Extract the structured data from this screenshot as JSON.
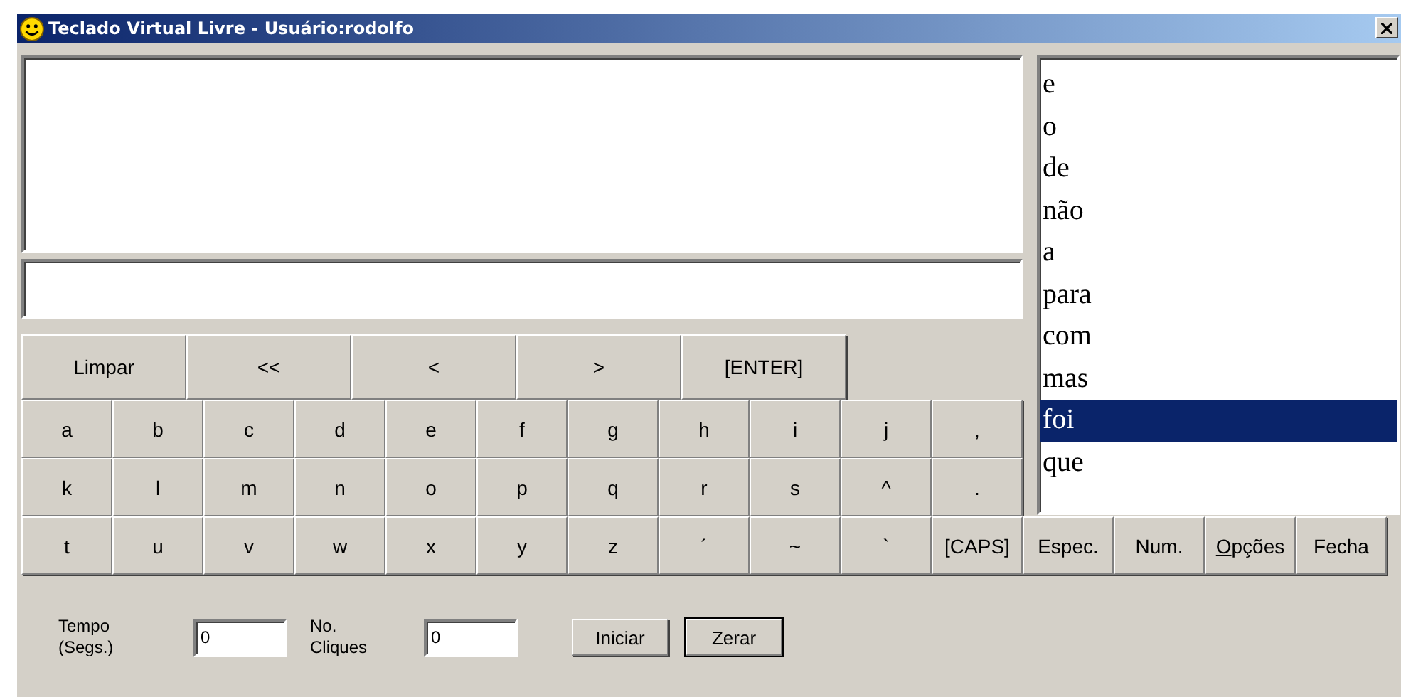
{
  "window": {
    "title": "Teclado Virtual Livre - Usuário:rodolfo"
  },
  "command_buttons": [
    "Limpar",
    "<<",
    "<",
    ">",
    "[ENTER]"
  ],
  "words": [
    {
      "label": "e",
      "selected": false
    },
    {
      "label": "o",
      "selected": false
    },
    {
      "label": "de",
      "selected": false
    },
    {
      "label": "não",
      "selected": false
    },
    {
      "label": "a",
      "selected": false
    },
    {
      "label": "para",
      "selected": false
    },
    {
      "label": "com",
      "selected": false
    },
    {
      "label": "mas",
      "selected": false
    },
    {
      "label": "foi",
      "selected": true
    },
    {
      "label": "que",
      "selected": false
    }
  ],
  "key_rows": [
    [
      "a",
      "b",
      "c",
      "d",
      "e",
      "f",
      "g",
      "h",
      "i",
      "j",
      ","
    ],
    [
      "k",
      "l",
      "m",
      "n",
      "o",
      "p",
      "q",
      "r",
      "s",
      "^",
      "."
    ],
    [
      "t",
      "u",
      "v",
      "w",
      "x",
      "y",
      "z",
      "´",
      "~",
      "`",
      "[CAPS]",
      "Espec.",
      "Num.",
      {
        "label": "Opções",
        "underline_first": true
      },
      "Fecha"
    ]
  ],
  "footer": {
    "time_label": "Tempo\n(Segs.)",
    "time_value": "0",
    "clicks_label": "No.\nCliques",
    "clicks_value": "0",
    "buttons": [
      {
        "label": "Iniciar",
        "default": false
      },
      {
        "label": "Zerar",
        "default": true
      }
    ]
  }
}
